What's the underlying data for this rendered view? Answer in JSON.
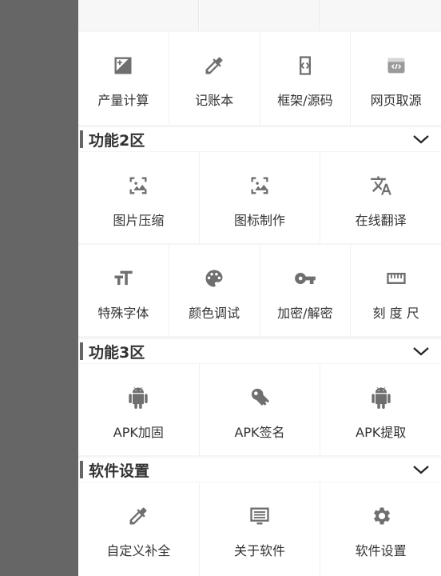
{
  "colors": {
    "scrim": "#666666",
    "icon": "#6f6f6f",
    "text": "#333333",
    "tile": "#ffffff",
    "divider": "#f0f0f0"
  },
  "top_row": {
    "cells": 3
  },
  "section1": {
    "items": [
      {
        "label": "产量计算",
        "icon": "exposure-plus-minus-icon"
      },
      {
        "label": "记账本",
        "icon": "eyedropper-icon"
      },
      {
        "label": "框架/源码",
        "icon": "code-frame-icon"
      },
      {
        "label": "网页取源",
        "icon": "web-source-icon"
      }
    ]
  },
  "section2": {
    "title": "功能2区",
    "row1": [
      {
        "label": "图片压缩",
        "icon": "image-icon"
      },
      {
        "label": "图标制作",
        "icon": "image-icon"
      },
      {
        "label": "在线翻译",
        "icon": "translate-icon"
      }
    ],
    "row2": [
      {
        "label": "特殊字体",
        "icon": "font-size-icon"
      },
      {
        "label": "颜色调试",
        "icon": "palette-icon"
      },
      {
        "label": "加密/解密",
        "icon": "key-icon"
      },
      {
        "label": "刻 度 尺",
        "icon": "ruler-icon"
      }
    ]
  },
  "section3": {
    "title": "功能3区",
    "items": [
      {
        "label": "APK加固",
        "icon": "android-icon"
      },
      {
        "label": "APK签名",
        "icon": "vpn-key-icon"
      },
      {
        "label": "APK提取",
        "icon": "android-icon"
      }
    ]
  },
  "section4": {
    "title": "软件设置",
    "items": [
      {
        "label": "自定义补全",
        "icon": "eyedropper-icon"
      },
      {
        "label": "关于软件",
        "icon": "list-screen-icon"
      },
      {
        "label": "软件设置",
        "icon": "gear-icon"
      }
    ]
  }
}
